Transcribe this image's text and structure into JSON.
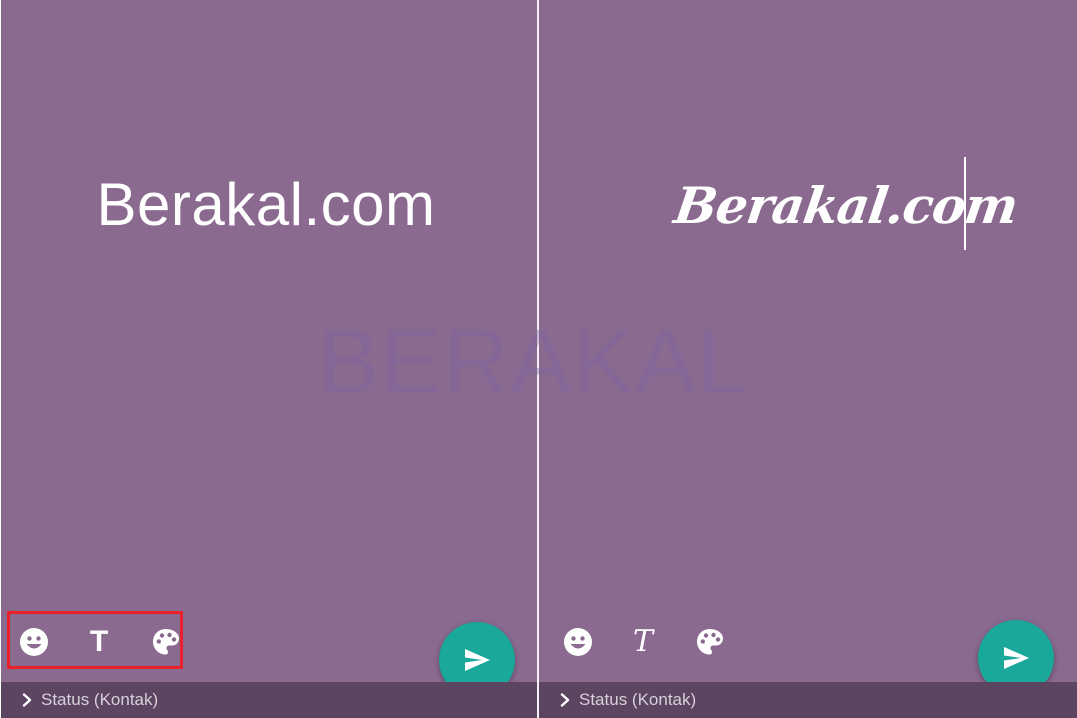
{
  "colors": {
    "background": "#8b6a90",
    "bottom_bar": "#5c4560",
    "send_button": "#19a89a",
    "highlight_box": "#e8212a",
    "text": "#ffffff"
  },
  "left_panel": {
    "status_text": "Berakal.com",
    "text_style": "sans-serif",
    "toolbar": {
      "emoji_icon": "smiley-icon",
      "text_icon": "text-T-icon",
      "text_label": "T",
      "palette_icon": "palette-icon"
    },
    "send_icon": "send-arrow-icon",
    "bottom_bar": {
      "chevron_icon": "chevron-right-icon",
      "label": "Status (Kontak)"
    }
  },
  "right_panel": {
    "status_text": "Berakal.com",
    "text_style": "script",
    "toolbar": {
      "emoji_icon": "smiley-icon",
      "text_icon": "text-script-T-icon",
      "text_label": "T",
      "palette_icon": "palette-icon"
    },
    "send_icon": "send-arrow-icon",
    "bottom_bar": {
      "chevron_icon": "chevron-right-icon",
      "label": "Status (Kontak)"
    }
  },
  "watermark": "BERAKAL"
}
